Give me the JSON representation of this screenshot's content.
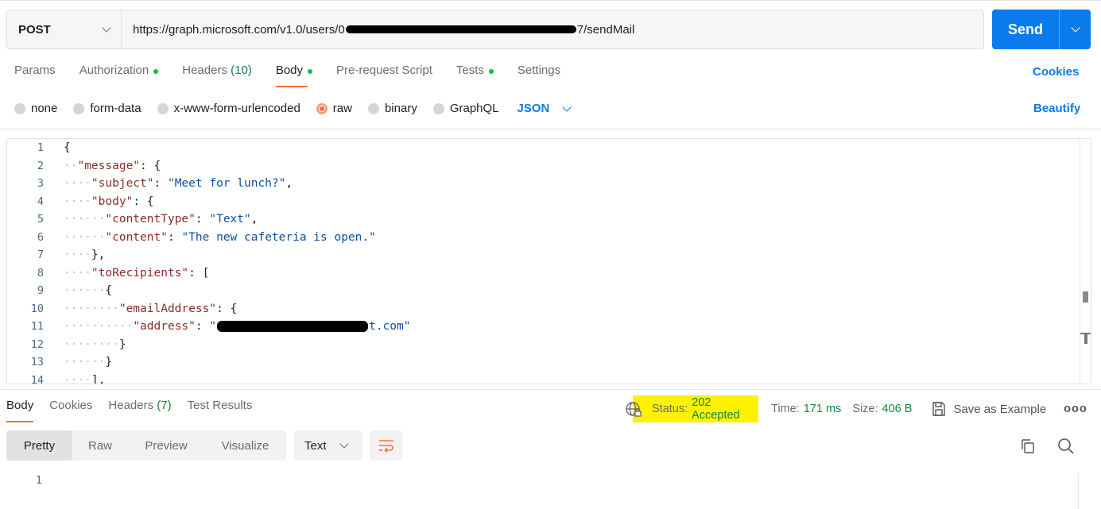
{
  "request": {
    "method": "POST",
    "url_prefix": "https://graph.microsoft.com/v1.0/users/0",
    "url_suffix": "7/sendMail",
    "send_label": "Send"
  },
  "request_tabs": {
    "params": "Params",
    "authorization": "Authorization",
    "headers": "Headers",
    "headers_count": "(10)",
    "body": "Body",
    "prerequest": "Pre-request Script",
    "tests": "Tests",
    "settings": "Settings",
    "cookies": "Cookies"
  },
  "body_types": {
    "none": "none",
    "form_data": "form-data",
    "urlencoded": "x-www-form-urlencoded",
    "raw": "raw",
    "binary": "binary",
    "graphql": "GraphQL",
    "format": "JSON",
    "beautify": "Beautify"
  },
  "editor": {
    "line_numbers": [
      "1",
      "2",
      "3",
      "4",
      "5",
      "6",
      "7",
      "8",
      "9",
      "10",
      "11",
      "12",
      "13",
      "14"
    ],
    "code": {
      "l1": "{",
      "l2_key": "\"message\"",
      "l2_rest": ": {",
      "l3_key": "\"subject\"",
      "l3_val": "\"Meet for lunch?\"",
      "l3_end": ",",
      "l4_key": "\"body\"",
      "l4_rest": ": {",
      "l5_key": "\"contentType\"",
      "l5_val": "\"Text\"",
      "l5_end": ",",
      "l6_key": "\"content\"",
      "l6_val": "\"The new cafeteria is open.\"",
      "l7": "},",
      "l8_key": "\"toRecipients\"",
      "l8_rest": ": [",
      "l9": "{",
      "l10_key": "\"emailAddress\"",
      "l10_rest": ": {",
      "l11_key": "\"address\"",
      "l11_val_start": "\"",
      "l11_val_end": "t.com\"",
      "l12": "}",
      "l13": "}",
      "l14": "],"
    }
  },
  "response": {
    "tabs": {
      "body": "Body",
      "cookies": "Cookies",
      "headers": "Headers",
      "headers_count": "(7)",
      "test_results": "Test Results"
    },
    "status_label": "Status:",
    "status_value": "202 Accepted",
    "time_label": "Time:",
    "time_value": "171 ms",
    "size_label": "Size:",
    "size_value": "406 B",
    "save_example": "Save as Example",
    "more": "ooo",
    "views": {
      "pretty": "Pretty",
      "raw": "Raw",
      "preview": "Preview",
      "visualize": "Visualize"
    },
    "format": "Text",
    "line_numbers": [
      "1"
    ]
  },
  "colors": {
    "accent": "#ff6c37",
    "primary": "#097bed",
    "success": "#0cbb52",
    "highlight": "#fef200"
  }
}
